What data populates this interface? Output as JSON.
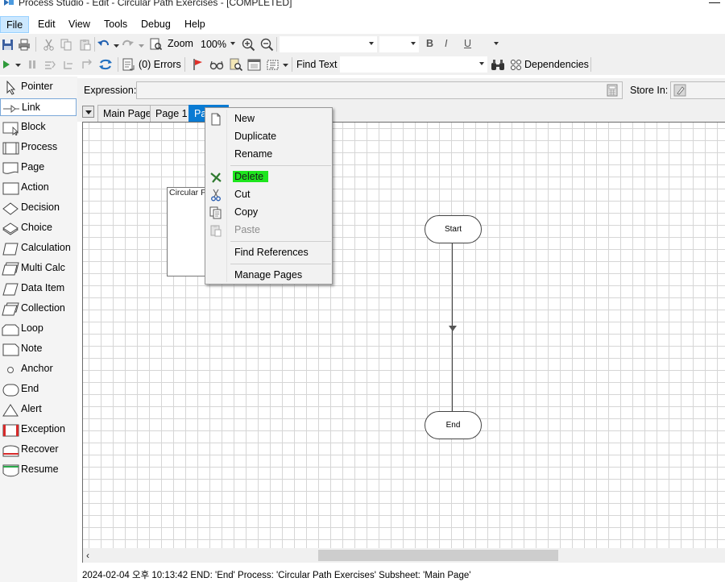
{
  "window": {
    "title": "Process Studio  - Edit - Circular Path Exercises - [COMPLETED]",
    "minimize_glyph": "—"
  },
  "menubar": {
    "items": [
      {
        "label": "File",
        "active": true
      },
      {
        "label": "Edit"
      },
      {
        "label": "View"
      },
      {
        "label": "Tools"
      },
      {
        "label": "Debug"
      },
      {
        "label": "Help"
      }
    ]
  },
  "toolbar": {
    "zoom_label": "Zoom",
    "zoom_value": "100%",
    "bold": "B",
    "italic": "I",
    "underline": "U",
    "errors_label": "(0) Errors",
    "find_text_label": "Find Text",
    "dependencies_label": "Dependencies"
  },
  "toolbox": {
    "items": [
      {
        "label": "Pointer",
        "icon": "pointer-icon"
      },
      {
        "label": "Link",
        "icon": "link-icon",
        "selected": true
      },
      {
        "label": "Block",
        "icon": "block-icon"
      },
      {
        "label": "Process",
        "icon": "process-icon"
      },
      {
        "label": "Page",
        "icon": "page-icon"
      },
      {
        "label": "Action",
        "icon": "action-icon"
      },
      {
        "label": "Decision",
        "icon": "decision-icon"
      },
      {
        "label": "Choice",
        "icon": "choice-icon"
      },
      {
        "label": "Calculation",
        "icon": "calculation-icon"
      },
      {
        "label": "Multi Calc",
        "icon": "multi-calc-icon"
      },
      {
        "label": "Data Item",
        "icon": "data-item-icon"
      },
      {
        "label": "Collection",
        "icon": "collection-icon"
      },
      {
        "label": "Loop",
        "icon": "loop-icon"
      },
      {
        "label": "Note",
        "icon": "note-icon"
      },
      {
        "label": "Anchor",
        "icon": "anchor-icon"
      },
      {
        "label": "End",
        "icon": "end-icon"
      },
      {
        "label": "Alert",
        "icon": "alert-icon"
      },
      {
        "label": "Exception",
        "icon": "exception-icon"
      },
      {
        "label": "Recover",
        "icon": "recover-icon"
      },
      {
        "label": "Resume",
        "icon": "resume-icon"
      }
    ]
  },
  "expression": {
    "label": "Expression:",
    "value": "",
    "store_label": "Store In:",
    "store_value": ""
  },
  "tabs": {
    "items": [
      {
        "label": "Main Page"
      },
      {
        "label": "Page 1"
      },
      {
        "label": "Pa",
        "active": true
      }
    ]
  },
  "canvas": {
    "block_label": "Circular Pa",
    "start_label": "Start",
    "end_label": "End"
  },
  "context_menu": {
    "items": [
      {
        "label": "New",
        "icon": "new-page-icon"
      },
      {
        "label": "Duplicate",
        "icon": ""
      },
      {
        "label": "Rename",
        "icon": ""
      },
      {
        "label": "Delete",
        "icon": "delete-icon",
        "highlighted": true
      },
      {
        "label": "Cut",
        "icon": "scissors-icon"
      },
      {
        "label": "Copy",
        "icon": "copy-icon"
      },
      {
        "label": "Paste",
        "icon": "paste-icon",
        "disabled": true
      },
      {
        "label": "Find References",
        "icon": ""
      },
      {
        "label": "Manage Pages",
        "icon": ""
      }
    ]
  },
  "statusbar": {
    "text": "2024-02-04 오후 10:13:42 END: 'End' Process: 'Circular Path Exercises' Subsheet: 'Main Page'"
  },
  "colors": {
    "active_tab": "#0a7bd3",
    "delete_highlight": "#1ee51e",
    "menu_active": "#cce8ff"
  }
}
